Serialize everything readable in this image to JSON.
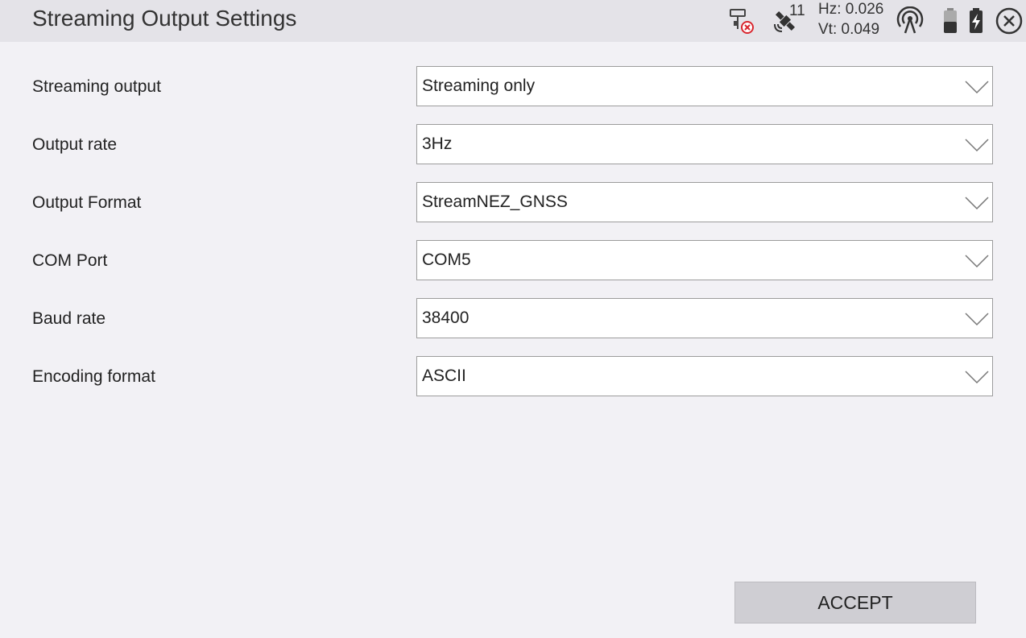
{
  "header": {
    "title": "Streaming Output Settings",
    "satellite_count": "11",
    "hz_precision": "Hz: 0.026",
    "vt_precision": "Vt: 0.049",
    "icons": [
      "receiver-disconnected-icon",
      "satellite-icon",
      "radio-signal-icon",
      "battery-icon",
      "battery-charging-icon",
      "close-icon"
    ]
  },
  "form": {
    "rows": [
      {
        "label": "Streaming output",
        "value": "Streaming only"
      },
      {
        "label": "Output rate",
        "value": "3Hz"
      },
      {
        "label": "Output Format",
        "value": "StreamNEZ_GNSS"
      },
      {
        "label": "COM Port",
        "value": "COM5"
      },
      {
        "label": "Baud rate",
        "value": "38400"
      },
      {
        "label": "Encoding format",
        "value": "ASCII"
      }
    ]
  },
  "footer": {
    "accept_label": "ACCEPT"
  },
  "colors": {
    "header_bg": "#e4e3e8",
    "page_bg": "#f2f1f5",
    "button_bg": "#cfced3",
    "error_red": "#d9262e"
  }
}
